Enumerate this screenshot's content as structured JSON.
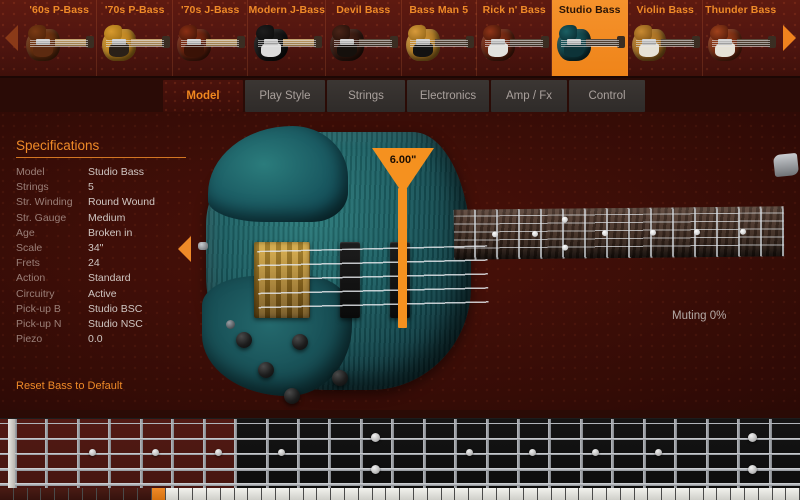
{
  "header": {
    "prev_arrow_icon": "triangle-left-icon",
    "next_arrow_icon": "triangle-right-icon",
    "models": [
      {
        "name": "'60s P-Bass",
        "selected": false,
        "body": "#7a3a14",
        "accent": "#4a2008",
        "neck": "light",
        "pg": "#5c2a10"
      },
      {
        "name": "'70s P-Bass",
        "selected": false,
        "body": "#d89a2e",
        "accent": "#9a6a12",
        "neck": "light",
        "pg": "#2a2018"
      },
      {
        "name": "'70s J-Bass",
        "selected": false,
        "body": "#8a2f14",
        "accent": "#3a1206",
        "neck": "light",
        "pg": "#3a1206"
      },
      {
        "name": "Modern J-Bass",
        "selected": false,
        "body": "#1d1d1d",
        "accent": "#0a0a0a",
        "neck": "light",
        "pg": "#dcdcdc"
      },
      {
        "name": "Devil Bass",
        "selected": false,
        "body": "#4a2418",
        "accent": "#1f0d06",
        "neck": "dark",
        "pg": "#15100c"
      },
      {
        "name": "Bass Man 5",
        "selected": false,
        "body": "#d89a3a",
        "accent": "#8a5f14",
        "neck": "dark",
        "pg": "#121212"
      },
      {
        "name": "Rick n' Bass",
        "selected": false,
        "body": "#8f3418",
        "accent": "#3a1206",
        "neck": "dark",
        "pg": "#e2e2de"
      },
      {
        "name": "Studio Bass",
        "selected": true,
        "body": "#1b5f63",
        "accent": "#07262b",
        "neck": "dark",
        "pg": "#0d3338"
      },
      {
        "name": "Violin Bass",
        "selected": false,
        "body": "#c98a32",
        "accent": "#7a4e12",
        "neck": "dark",
        "pg": "#e6e2d6"
      },
      {
        "name": "Thunder Bass",
        "selected": false,
        "body": "#a0421c",
        "accent": "#4a1708",
        "neck": "dark",
        "pg": "#e6e2d6"
      }
    ]
  },
  "tabs": [
    {
      "label": "Model",
      "active": true
    },
    {
      "label": "Play Style",
      "active": false
    },
    {
      "label": "Strings",
      "active": false
    },
    {
      "label": "Electronics",
      "active": false
    },
    {
      "label": "Amp / Fx",
      "active": false
    },
    {
      "label": "Control",
      "active": false
    }
  ],
  "specifications": {
    "title": "Specifications",
    "rows": [
      {
        "key": "Model",
        "value": "Studio Bass"
      },
      {
        "key": "Strings",
        "value": "5"
      },
      {
        "key": "Str. Winding",
        "value": "Round Wound"
      },
      {
        "key": "Str. Gauge",
        "value": "Medium"
      },
      {
        "key": "Age",
        "value": "Broken in"
      },
      {
        "key": "Scale",
        "value": "34\""
      },
      {
        "key": "Frets",
        "value": "24"
      },
      {
        "key": "Action",
        "value": "Standard"
      },
      {
        "key": "Circuitry",
        "value": "Active"
      },
      {
        "key": "Pick-up B",
        "value": "Studio BSC"
      },
      {
        "key": "Pick-up N",
        "value": "Studio NSC"
      },
      {
        "key": "Piezo",
        "value": "0.0"
      }
    ],
    "reset_label": "Reset Bass to Default",
    "collapse_arrow_icon": "triangle-left-icon"
  },
  "stage": {
    "marker_value": "6.00\"",
    "muting_label": "Muting 0%"
  },
  "colors": {
    "accent_orange": "#ef8a28",
    "background_maroon": "#3a0d07",
    "header_maroon": "#501510",
    "guitar_teal": "#1b5f63",
    "spec_key_grey": "#9a7f78",
    "spec_value_grey": "#cfc6c2"
  },
  "fretboard": {
    "fret_count": 25,
    "string_count": 5,
    "lit_frets": 7,
    "inlay_frets": [
      3,
      5,
      7,
      9,
      12,
      15,
      17,
      19,
      21,
      24
    ],
    "double_inlay_frets": [
      12,
      24
    ]
  }
}
